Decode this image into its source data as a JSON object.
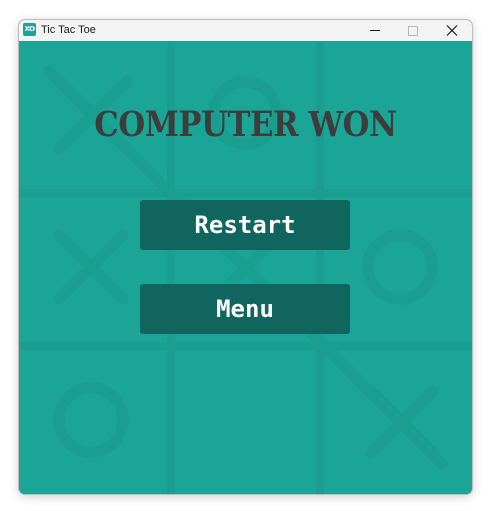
{
  "window": {
    "title": "Tic Tac Toe",
    "icon": "tic-tac-toe-app-icon",
    "icon_glyph": "XO",
    "controls": [
      "minimize-icon",
      "maximize-icon",
      "close-icon"
    ]
  },
  "game": {
    "status_text": "COMPUTER WON",
    "restart_label": "Restart",
    "menu_label": "Menu",
    "board_marks": [
      "X",
      "O",
      "",
      "",
      "X",
      "O",
      "O",
      "",
      "X"
    ]
  },
  "colors": {
    "board_background": "#1aa596",
    "grid_and_marks": "#199e90",
    "button_background": "#10655f",
    "button_text": "#ffffff",
    "status_text": "#3d3d3d"
  }
}
